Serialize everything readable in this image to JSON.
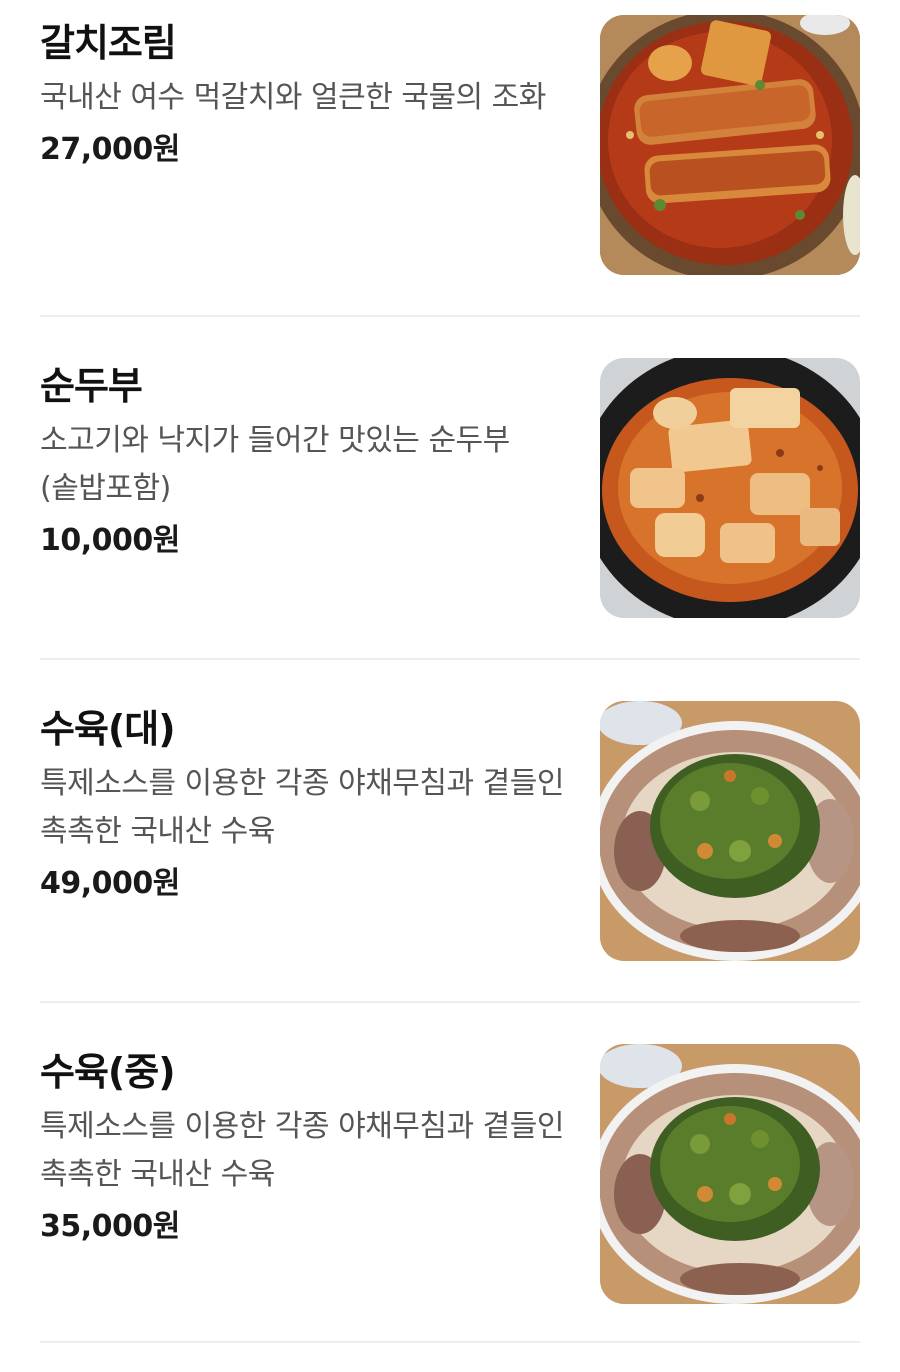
{
  "menu": {
    "items": [
      {
        "name": "갈치조림",
        "description": "국내산 여수 먹갈치와 얼큰한 국물의 조화",
        "price": "27,000원",
        "photo_icon": "braised-cutlassfish-photo"
      },
      {
        "name": "순두부",
        "description": "소고기와 낙지가 들어간 맛있는 순두부(솥밥포함)",
        "price": "10,000원",
        "photo_icon": "soft-tofu-stew-photo"
      },
      {
        "name": "수육(대)",
        "description": "특제소스를 이용한 각종 야채무침과 곁들인 촉촉한 국내산 수육",
        "price": "49,000원",
        "photo_icon": "boiled-pork-platter-photo"
      },
      {
        "name": "수육(중)",
        "description": "특제소스를 이용한 각종 야채무침과 곁들인 촉촉한 국내산 수육",
        "price": "35,000원",
        "photo_icon": "boiled-pork-platter-photo"
      }
    ]
  },
  "colors": {
    "background": "#ffffff",
    "name_text": "#111111",
    "description_text": "#555555",
    "divider": "#eeeeee"
  }
}
